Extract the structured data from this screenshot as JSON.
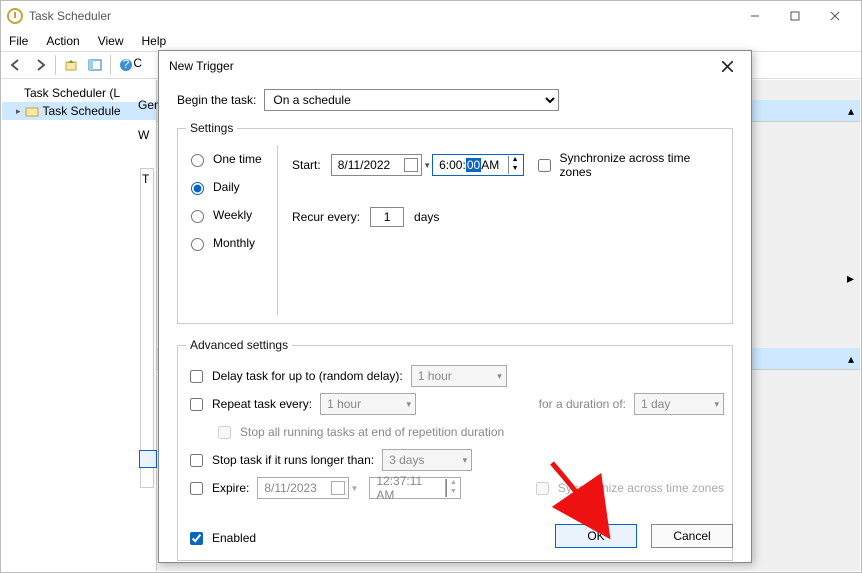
{
  "window": {
    "title": "Task Scheduler",
    "menus": [
      "File",
      "Action",
      "View",
      "Help"
    ]
  },
  "tree": {
    "root": "Task Scheduler (L",
    "lib": "Task Schedule"
  },
  "behind": {
    "gen": "Gen",
    "w": "W",
    "t": "T"
  },
  "dialog": {
    "title": "New Trigger",
    "begin_label": "Begin the task:",
    "begin_value": "On a schedule",
    "settings_legend": "Settings",
    "freq": {
      "one": "One time",
      "daily": "Daily",
      "weekly": "Weekly",
      "monthly": "Monthly"
    },
    "start_label": "Start:",
    "start_date": "8/11/2022",
    "start_time_pre": "6:00:",
    "start_time_sel": "00",
    "start_time_post": " AM",
    "sync_label": "Synchronize across time zones",
    "recur_label": "Recur every:",
    "recur_value": "1",
    "recur_unit": "days",
    "adv_legend": "Advanced settings",
    "delay_label": "Delay task for up to (random delay):",
    "delay_value": "1 hour",
    "repeat_label": "Repeat task every:",
    "repeat_value": "1 hour",
    "duration_label": "for a duration of:",
    "duration_value": "1 day",
    "stop_repeat_label": "Stop all running tasks at end of repetition duration",
    "stop_longer_label": "Stop task if it runs longer than:",
    "stop_longer_value": "3 days",
    "expire_label": "Expire:",
    "expire_date": "8/11/2023",
    "expire_time": "12:37:11 AM",
    "expire_sync": "Synchronize across time zones",
    "enabled_label": "Enabled",
    "ok": "OK",
    "cancel": "Cancel"
  }
}
